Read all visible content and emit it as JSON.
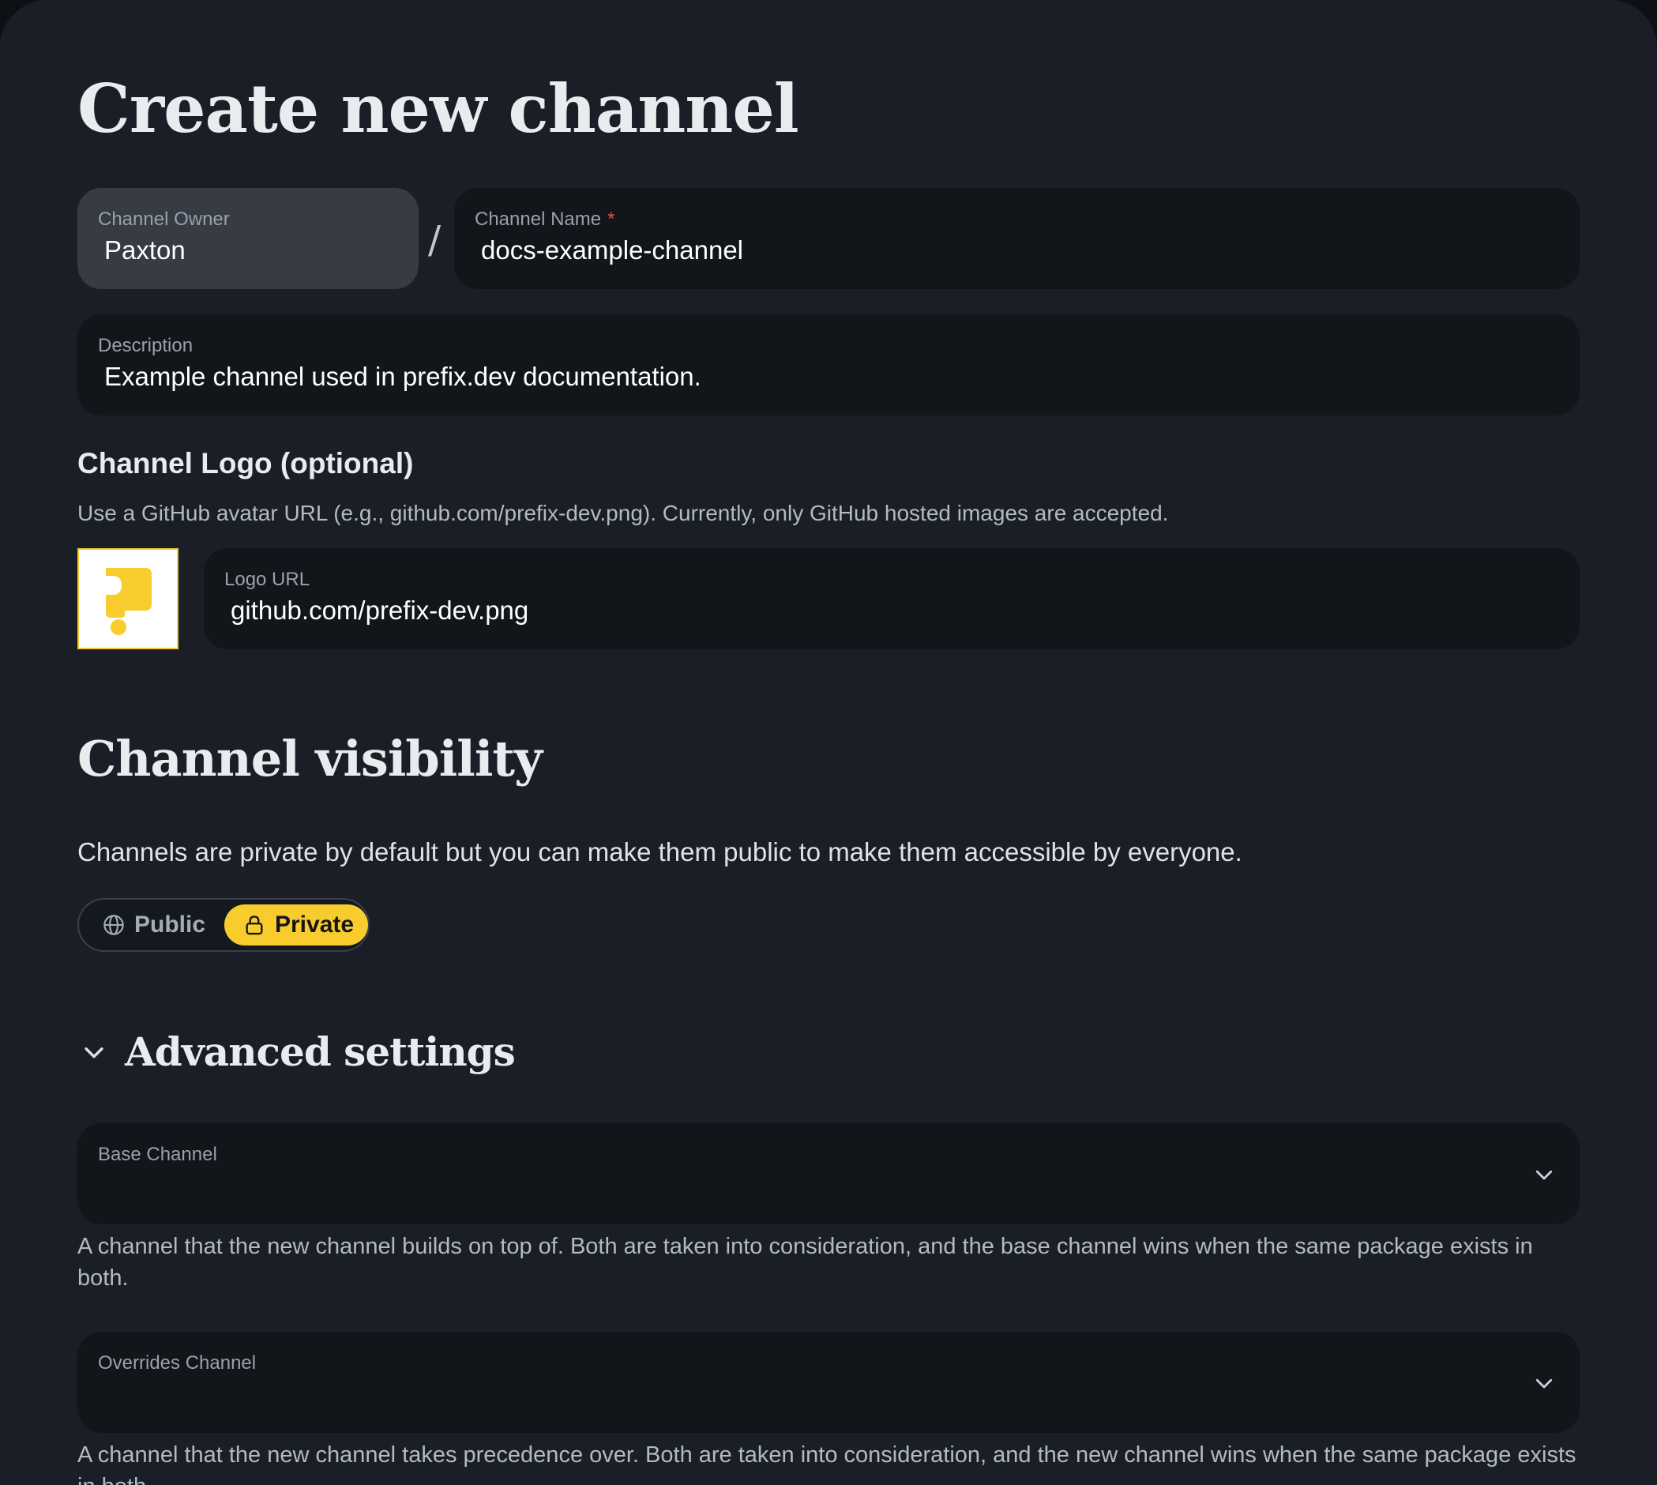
{
  "page": {
    "title": "Create new channel"
  },
  "form": {
    "owner": {
      "label": "Channel Owner",
      "value": "Paxton"
    },
    "separator": "/",
    "name": {
      "label": "Channel Name",
      "required_mark": "*",
      "value": "docs-example-channel"
    },
    "description": {
      "label": "Description",
      "value": "Example channel used in prefix.dev documentation."
    }
  },
  "logo": {
    "heading": "Channel Logo (optional)",
    "note": "Use a GitHub avatar URL (e.g., github.com/prefix-dev.png). Currently, only GitHub hosted images are accepted.",
    "field_label": "Logo URL",
    "field_value": "github.com/prefix-dev.png",
    "preview_icon": "prefix-logo-icon",
    "preview_color": "#f8cc2c"
  },
  "visibility": {
    "heading": "Channel visibility",
    "description": "Channels are private by default but you can make them public to make them accessible by everyone.",
    "options": [
      {
        "label": "Public",
        "icon": "globe-icon",
        "selected": false
      },
      {
        "label": "Private",
        "icon": "lock-icon",
        "selected": true
      }
    ],
    "selected": "Private"
  },
  "advanced": {
    "heading": "Advanced settings",
    "expanded": true,
    "base_channel": {
      "label": "Base Channel",
      "value": "",
      "help": "A channel that the new channel builds on top of. Both are taken into consideration, and the base channel wins when the same package exists in both."
    },
    "overrides_channel": {
      "label": "Overrides Channel",
      "value": "",
      "help": "A channel that the new channel takes precedence over. Both are taken into consideration, and the new channel wins when the same package exists in both."
    }
  },
  "colors": {
    "background": "#1a1f27",
    "field": "#12161b",
    "field_disabled": "#363b44",
    "accent": "#f8cc2c",
    "required": "#e0523b"
  }
}
